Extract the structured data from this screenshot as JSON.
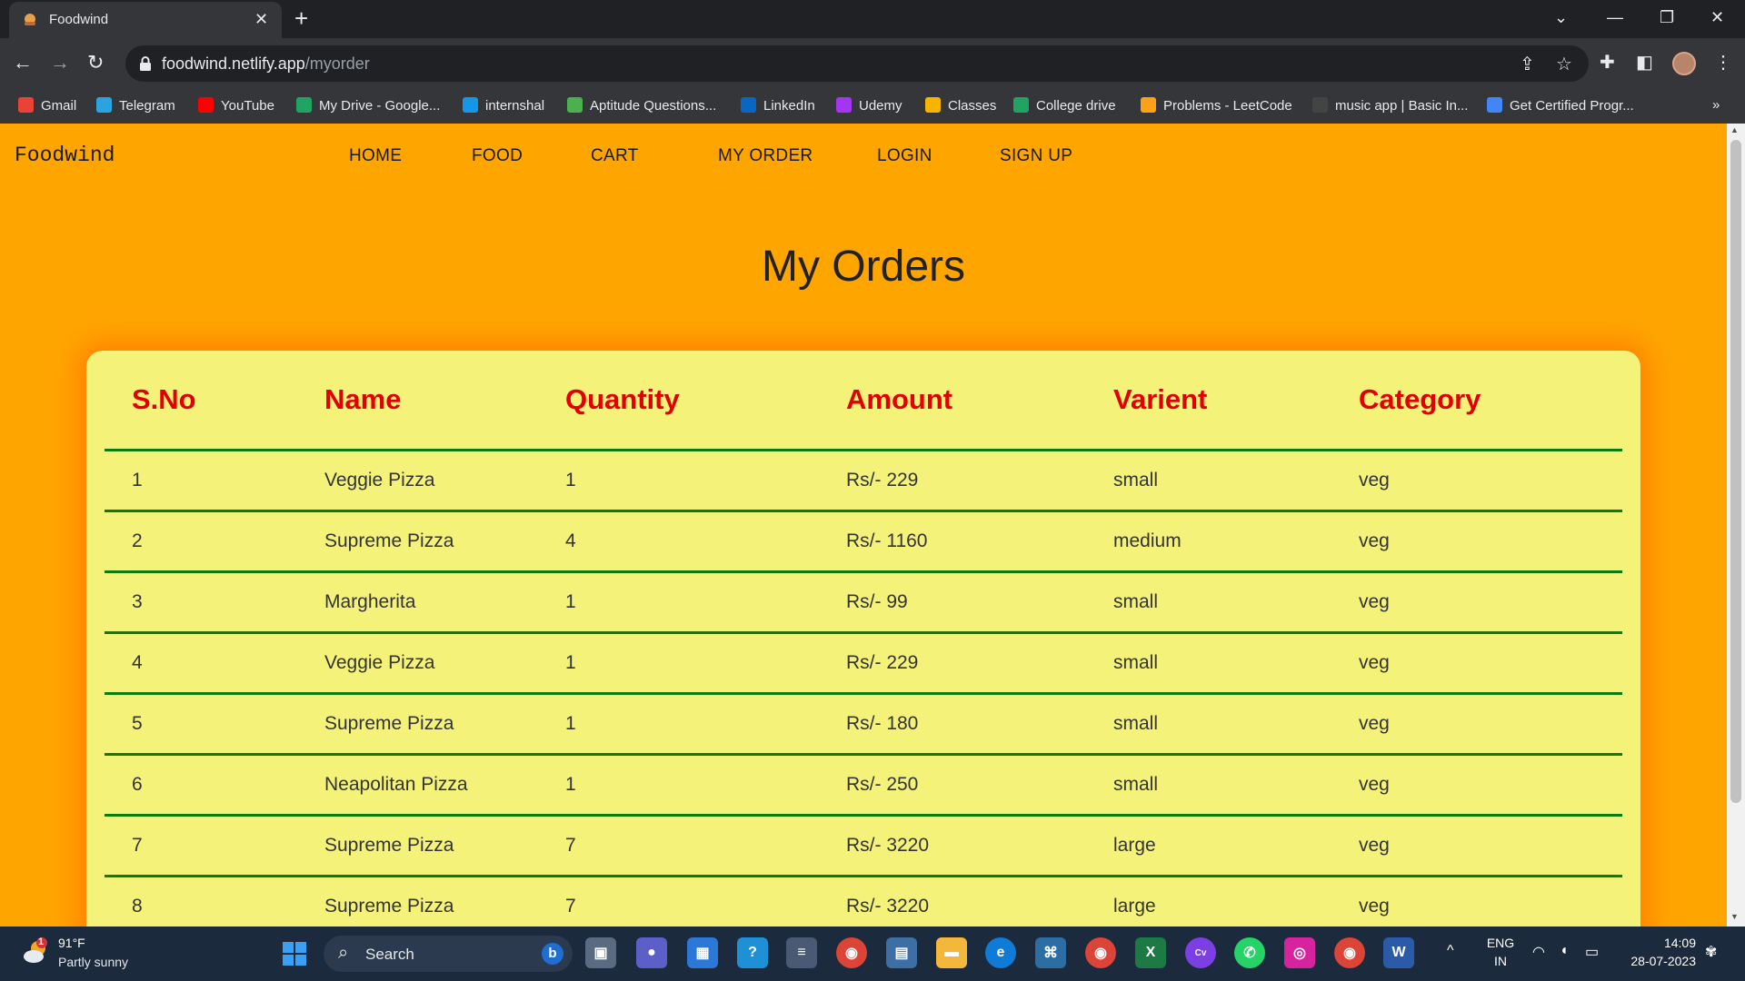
{
  "browser": {
    "tab_title": "Foodwind",
    "tab_close": "✕",
    "new_tab": "+",
    "url_host": "foodwind.netlify.app",
    "url_path": "/myorder",
    "bookmarks_overflow": "»",
    "bookmarks": [
      {
        "label": "Gmail",
        "icon": "gmail-icon",
        "color": "#ea4335"
      },
      {
        "label": "Telegram",
        "icon": "telegram-icon",
        "color": "#2aa3e0"
      },
      {
        "label": "YouTube",
        "icon": "youtube-icon",
        "color": "#ff0000"
      },
      {
        "label": "My Drive - Google...",
        "icon": "drive-icon",
        "color": "#1fa463"
      },
      {
        "label": "internshal",
        "icon": "internshala-icon",
        "color": "#1597e5"
      },
      {
        "label": "Aptitude Questions...",
        "icon": "aptitude-icon",
        "color": "#4caf50"
      },
      {
        "label": "LinkedIn",
        "icon": "linkedin-icon",
        "color": "#0a66c2"
      },
      {
        "label": "Udemy",
        "icon": "udemy-icon",
        "color": "#a435f0"
      },
      {
        "label": "Classes",
        "icon": "classroom-icon",
        "color": "#f4b400"
      },
      {
        "label": "College drive",
        "icon": "drive-icon",
        "color": "#1fa463"
      },
      {
        "label": "Problems - LeetCode",
        "icon": "leetcode-icon",
        "color": "#ffa116"
      },
      {
        "label": "music app | Basic In...",
        "icon": "music-icon",
        "color": "#444444"
      },
      {
        "label": "Get Certified Progr...",
        "icon": "certified-icon",
        "color": "#4285f4"
      }
    ]
  },
  "site": {
    "brand": "Foodwind",
    "nav": [
      "HOME",
      "FOOD",
      "CART",
      "MY ORDER",
      "LOGIN",
      "SIGN UP"
    ],
    "title": "My Orders"
  },
  "orders": {
    "headers": [
      "S.No",
      "Name",
      "Quantity",
      "Amount",
      "Varient",
      "Category"
    ],
    "rows": [
      [
        "1",
        "Veggie Pizza",
        "1",
        "Rs/- 229",
        "small",
        "veg"
      ],
      [
        "2",
        "Supreme Pizza",
        "4",
        "Rs/- 1160",
        "medium",
        "veg"
      ],
      [
        "3",
        "Margherita",
        "1",
        "Rs/- 99",
        "small",
        "veg"
      ],
      [
        "4",
        "Veggie Pizza",
        "1",
        "Rs/- 229",
        "small",
        "veg"
      ],
      [
        "5",
        "Supreme Pizza",
        "1",
        "Rs/- 180",
        "small",
        "veg"
      ],
      [
        "6",
        "Neapolitan Pizza",
        "1",
        "Rs/- 250",
        "small",
        "veg"
      ],
      [
        "7",
        "Supreme Pizza",
        "7",
        "Rs/- 3220",
        "large",
        "veg"
      ],
      [
        "8",
        "Supreme Pizza",
        "7",
        "Rs/- 3220",
        "large",
        "veg"
      ]
    ]
  },
  "taskbar": {
    "weather_temp": "91°F",
    "weather_desc": "Partly sunny",
    "weather_badge": "1",
    "search_label": "Search",
    "language": "ENG",
    "region": "IN",
    "time": "14:09",
    "date": "28-07-2023"
  },
  "colors": {
    "page_bg": "#ffa500",
    "card_bg": "#f5f27a",
    "header_text": "#e00000",
    "row_divider": "#0a7a0a"
  }
}
